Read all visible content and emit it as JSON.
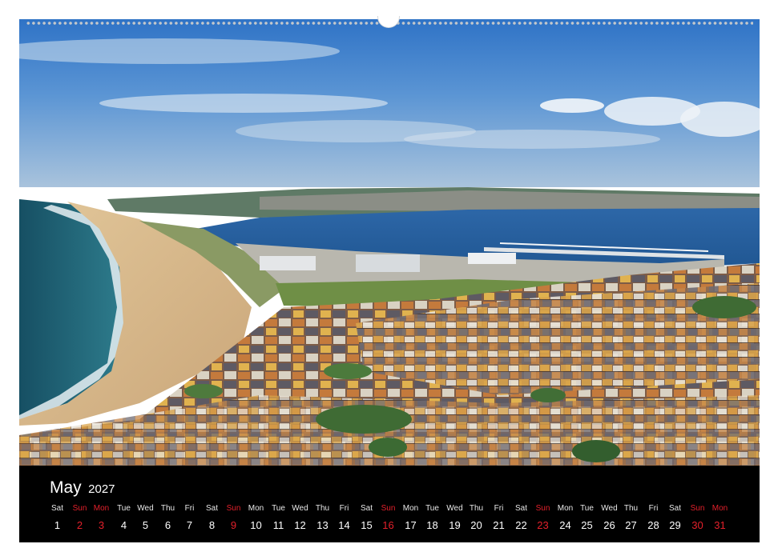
{
  "calendar": {
    "month": "May",
    "year": "2027",
    "accent_color": "#e4202b",
    "days": [
      {
        "wd": "Sat",
        "num": "1",
        "red": false
      },
      {
        "wd": "Sun",
        "num": "2",
        "red": true
      },
      {
        "wd": "Mon",
        "num": "3",
        "red": true
      },
      {
        "wd": "Tue",
        "num": "4",
        "red": false
      },
      {
        "wd": "Wed",
        "num": "5",
        "red": false
      },
      {
        "wd": "Thu",
        "num": "6",
        "red": false
      },
      {
        "wd": "Fri",
        "num": "7",
        "red": false
      },
      {
        "wd": "Sat",
        "num": "8",
        "red": false
      },
      {
        "wd": "Sun",
        "num": "9",
        "red": true
      },
      {
        "wd": "Mon",
        "num": "10",
        "red": false
      },
      {
        "wd": "Tue",
        "num": "11",
        "red": false
      },
      {
        "wd": "Wed",
        "num": "12",
        "red": false
      },
      {
        "wd": "Thu",
        "num": "13",
        "red": false
      },
      {
        "wd": "Fri",
        "num": "14",
        "red": false
      },
      {
        "wd": "Sat",
        "num": "15",
        "red": false
      },
      {
        "wd": "Sun",
        "num": "16",
        "red": true
      },
      {
        "wd": "Mon",
        "num": "17",
        "red": false
      },
      {
        "wd": "Tue",
        "num": "18",
        "red": false
      },
      {
        "wd": "Wed",
        "num": "19",
        "red": false
      },
      {
        "wd": "Thu",
        "num": "20",
        "red": false
      },
      {
        "wd": "Fri",
        "num": "21",
        "red": false
      },
      {
        "wd": "Sat",
        "num": "22",
        "red": false
      },
      {
        "wd": "Sun",
        "num": "23",
        "red": true
      },
      {
        "wd": "Mon",
        "num": "24",
        "red": false
      },
      {
        "wd": "Tue",
        "num": "25",
        "red": false
      },
      {
        "wd": "Wed",
        "num": "26",
        "red": false
      },
      {
        "wd": "Thu",
        "num": "27",
        "red": false
      },
      {
        "wd": "Fri",
        "num": "28",
        "red": false
      },
      {
        "wd": "Sat",
        "num": "29",
        "red": false
      },
      {
        "wd": "Sun",
        "num": "30",
        "red": true
      },
      {
        "wd": "Mon",
        "num": "31",
        "red": true
      }
    ]
  }
}
